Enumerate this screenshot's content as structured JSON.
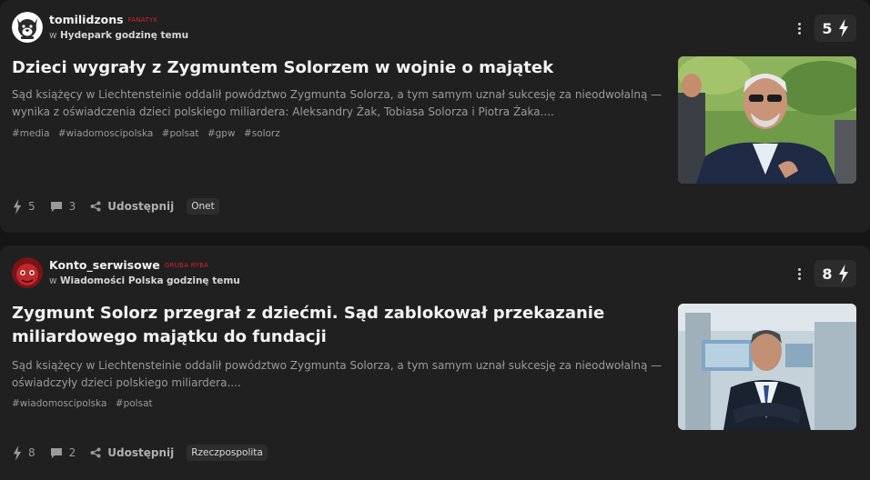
{
  "posts": [
    {
      "author": "tomilidzons",
      "rank": "FANATYK",
      "meta_prefix": "w",
      "community": "Hydepark",
      "time": "godzinę temu",
      "votes": "5",
      "title": "Dzieci wygrały z Zygmuntem Solorzem w wojnie o majątek",
      "excerpt": "Sąd książęcy w Liechtensteinie oddalił powództwo Zygmunta Solorza, a tym samym uznał sukcesję za nieodwołalną — wynika z oświadczenia dzieci polskiego miliardera: Aleksandry Żak, Tobiasa Solorza i Piotra Żaka....",
      "tags": [
        "#media",
        "#wiadomoscipolska",
        "#polsat",
        "#gpw",
        "#solorz"
      ],
      "reactions": "5",
      "comments": "3",
      "share_label": "Udostępnij",
      "source": "Onet",
      "colors": {
        "avatar_bg": "#ffffff",
        "thumb_bg": "#6f9a48"
      }
    },
    {
      "author": "Konto_serwisowe",
      "rank": "GRUBA RYBA",
      "meta_prefix": "w",
      "community": "Wiadomości Polska",
      "time": "godzinę temu",
      "votes": "8",
      "title": "Zygmunt Solorz przegrał z dziećmi. Sąd zablokował przekazanie miliardowego majątku do fundacji",
      "excerpt": "Sąd książęcy w Liechtensteinie oddalił powództwo Zygmunta Solorza, a tym samym uznał sukcesję za nieodwołalną — oświadczyły dzieci polskiego miliardera....",
      "tags": [
        "#wiadomoscipolska",
        "#polsat"
      ],
      "reactions": "8",
      "comments": "2",
      "share_label": "Udostępnij",
      "source": "Rzeczpospolita",
      "colors": {
        "avatar_bg": "#c0282c",
        "thumb_bg": "#b9c9d3"
      }
    }
  ],
  "icons": {
    "more": "vertical-dots-icon",
    "vote": "lightning-icon",
    "reaction": "lightning-icon",
    "comment": "comment-bubble-icon",
    "share": "share-icon"
  },
  "colors": {
    "page_bg": "#151515",
    "card_bg": "#202020",
    "rank": "#d3242c"
  }
}
